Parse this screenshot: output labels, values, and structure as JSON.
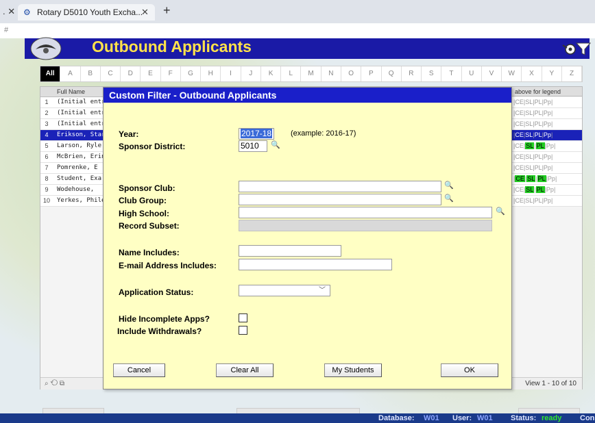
{
  "browser": {
    "tab_title": "Rotary D5010 Youth Excha...",
    "url_text": "#"
  },
  "app": {
    "title": "Outbound Applicants"
  },
  "letters": [
    "All",
    "A",
    "B",
    "C",
    "D",
    "E",
    "F",
    "G",
    "H",
    "I",
    "J",
    "K",
    "L",
    "M",
    "N",
    "O",
    "P",
    "Q",
    "R",
    "S",
    "T",
    "U",
    "V",
    "W",
    "X",
    "Y",
    "Z"
  ],
  "grid": {
    "header_name": "Full Name",
    "header_legend": "above for legend",
    "rows": [
      {
        "num": "1",
        "name": "(Initial entry",
        "flags": [
          {
            "t": "CE",
            "on": false
          },
          {
            "t": "SL",
            "on": false
          },
          {
            "t": "PL",
            "on": false
          },
          {
            "t": "Pp",
            "on": false
          }
        ]
      },
      {
        "num": "2",
        "name": "(Initial entry",
        "flags": [
          {
            "t": "CE",
            "on": false
          },
          {
            "t": "SL",
            "on": false
          },
          {
            "t": "PL",
            "on": false
          },
          {
            "t": "Pp",
            "on": false
          }
        ]
      },
      {
        "num": "3",
        "name": "(Initial entry",
        "flags": [
          {
            "t": "CE",
            "on": false
          },
          {
            "t": "SL",
            "on": false
          },
          {
            "t": "PL",
            "on": false
          },
          {
            "t": "Pp",
            "on": false
          }
        ]
      },
      {
        "num": "4",
        "name": "Erikson, Star",
        "flags": [
          {
            "t": "CE",
            "on": false
          },
          {
            "t": "SL",
            "on": false
          },
          {
            "t": "PL",
            "on": false
          },
          {
            "t": "Pp",
            "on": false
          }
        ],
        "selected": true
      },
      {
        "num": "5",
        "name": "Larson, Ryle",
        "flags": [
          {
            "t": "CE",
            "on": false
          },
          {
            "t": "SL",
            "on": true
          },
          {
            "t": "PL",
            "on": true
          },
          {
            "t": "Pp",
            "on": false
          }
        ]
      },
      {
        "num": "6",
        "name": "McBrien, Erin",
        "flags": [
          {
            "t": "CE",
            "on": false
          },
          {
            "t": "SL",
            "on": false
          },
          {
            "t": "PL",
            "on": false
          },
          {
            "t": "Pp",
            "on": false
          }
        ]
      },
      {
        "num": "7",
        "name": "Pomrenke, E",
        "flags": [
          {
            "t": "CE",
            "on": false
          },
          {
            "t": "SL",
            "on": false
          },
          {
            "t": "PL",
            "on": false
          },
          {
            "t": "Pp",
            "on": false
          }
        ]
      },
      {
        "num": "8",
        "name": "Student, Exa",
        "flags": [
          {
            "t": "CE",
            "on": true
          },
          {
            "t": "SL",
            "on": true
          },
          {
            "t": "PL",
            "on": true
          },
          {
            "t": "Pp",
            "on": false
          }
        ]
      },
      {
        "num": "9",
        "name": "Wodehouse,",
        "flags": [
          {
            "t": "CE",
            "on": false
          },
          {
            "t": "SL",
            "on": true
          },
          {
            "t": "PL",
            "on": true
          },
          {
            "t": "Pp",
            "on": false
          }
        ]
      },
      {
        "num": "10",
        "name": "Yerkes, Phile",
        "flags": [
          {
            "t": "CE",
            "on": false
          },
          {
            "t": "SL",
            "on": false
          },
          {
            "t": "PL",
            "on": false
          },
          {
            "t": "Pp",
            "on": false
          }
        ]
      }
    ],
    "view_count": "View 1 - 10 of 10"
  },
  "status_bar": {
    "database_label": "Database:",
    "database_value": "W01",
    "user_label": "User:",
    "user_value": "W01",
    "status_label": "Status:",
    "status_value": "ready",
    "trailing": "Con"
  },
  "dialog": {
    "title": "Custom Filter - Outbound Applicants",
    "year_label": "Year:",
    "year_value": "2017-18",
    "year_hint": "(example: 2016-17)",
    "sponsor_district_label": "Sponsor District:",
    "sponsor_district_value": "5010",
    "sponsor_club_label": "Sponsor Club:",
    "sponsor_club_value": "",
    "club_group_label": "Club Group:",
    "club_group_value": "",
    "high_school_label": "High School:",
    "high_school_value": "",
    "record_subset_label": "Record Subset:",
    "record_subset_value": "",
    "name_includes_label": "Name Includes:",
    "name_includes_value": "",
    "email_label": "E-mail Address Includes:",
    "email_value": "",
    "app_status_label": "Application Status:",
    "app_status_value": "",
    "hide_incomplete_label": "Hide Incomplete Apps?",
    "include_withdrawals_label": "Include Withdrawals?",
    "buttons": {
      "cancel": "Cancel",
      "clear_all": "Clear All",
      "my_students": "My Students",
      "ok": "OK"
    }
  }
}
